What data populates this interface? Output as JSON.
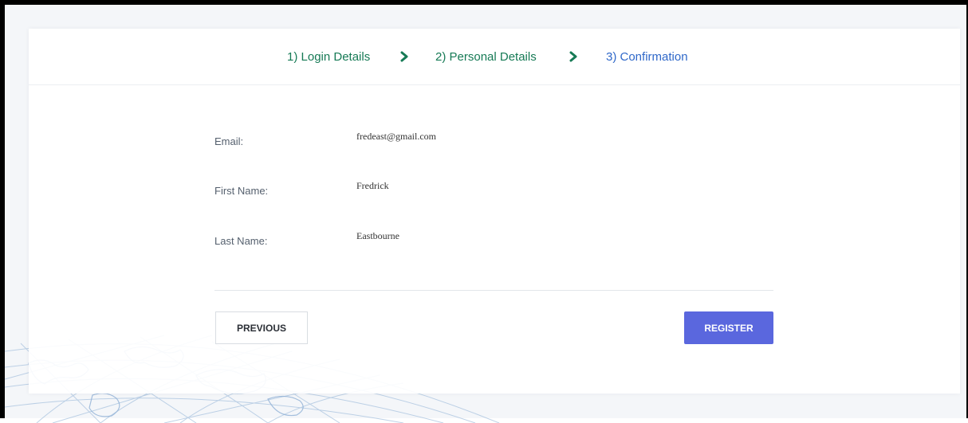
{
  "stepper": {
    "steps": [
      {
        "label": "1) Login Details"
      },
      {
        "label": "2) Personal Details"
      },
      {
        "label": "3) Confirmation"
      }
    ]
  },
  "summary": {
    "email": {
      "label": "Email:",
      "value": "fredeast@gmail.com"
    },
    "first_name": {
      "label": "First Name:",
      "value": "Fredrick"
    },
    "last_name": {
      "label": "Last Name:",
      "value": "Eastbourne"
    }
  },
  "actions": {
    "previous_label": "PREVIOUS",
    "register_label": "REGISTER"
  },
  "colors": {
    "step_done": "#167a55",
    "step_active": "#2f68c9",
    "primary_button": "#5a67de"
  }
}
